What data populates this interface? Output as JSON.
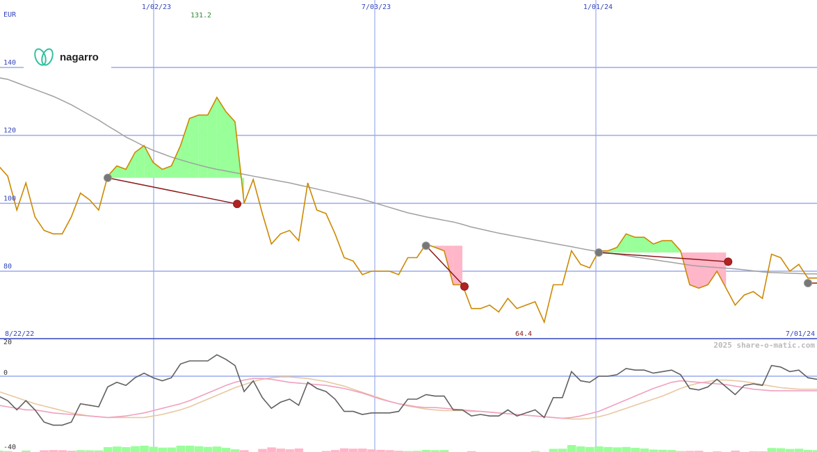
{
  "chart_data": [
    {
      "type": "line",
      "currency": "EUR",
      "y_ticks": [
        140,
        120,
        100,
        80
      ],
      "ylim": [
        64,
        145
      ],
      "date_labels": [
        "1/02/23",
        "7/03/23",
        "1/01/24"
      ],
      "start_date": "8/22/22",
      "end_date": "7/01/24",
      "max_label": "131.2",
      "min_label": "64.4",
      "series": [
        {
          "values": [
            111,
            108,
            98,
            106,
            96,
            92,
            91,
            91,
            96,
            103,
            101,
            98,
            108,
            111,
            110,
            115,
            117,
            112,
            110,
            111,
            117,
            125,
            126,
            126,
            131.2,
            127,
            124,
            100,
            107,
            97,
            88,
            91,
            92,
            89,
            106,
            98,
            97,
            91,
            84,
            83,
            79,
            80,
            80,
            80,
            79,
            84,
            84,
            88,
            87,
            86,
            76,
            76,
            69,
            69,
            70,
            68,
            72,
            69,
            70,
            71,
            65,
            76,
            76,
            86,
            82,
            81,
            86,
            86,
            87,
            91,
            90,
            90,
            88,
            89,
            89,
            86,
            76,
            75,
            76,
            80,
            75,
            70,
            73,
            74,
            72,
            85,
            84,
            80,
            82,
            78,
            78
          ]
        },
        {
          "values": [
            137,
            136.5,
            135.5,
            134.5,
            133.5,
            132.5,
            131.5,
            130.3,
            129,
            127.5,
            126,
            124.5,
            122.8,
            121.2,
            119.5,
            118.2,
            116.8,
            115.6,
            114.6,
            113.6,
            112.8,
            112,
            111.3,
            110.6,
            110,
            109.5,
            109,
            108.5,
            108,
            107.5,
            107,
            106.5,
            106,
            105.4,
            104.8,
            104.2,
            103.6,
            103,
            102.4,
            101.8,
            101.2,
            100.4,
            99.6,
            98.8,
            98,
            97.2,
            96.6,
            96,
            95.5,
            95,
            94.5,
            93.8,
            93,
            92.4,
            91.8,
            91.2,
            90.7,
            90.2,
            89.7,
            89.2,
            88.7,
            88.2,
            87.7,
            87.2,
            86.7,
            86.2,
            85.8,
            85.4,
            85,
            84.6,
            84.2,
            83.8,
            83.4,
            83,
            82.6,
            82.2,
            81.8,
            81.5,
            81.3,
            81.1,
            80.9,
            80.7,
            80.4,
            80.1,
            79.8,
            79.6,
            79.5,
            79.4,
            79.3,
            79.2,
            79.2
          ]
        }
      ],
      "trades": [
        {
          "entry": 107.5,
          "exit": 99.8,
          "result": "loss"
        },
        {
          "entry": 87.5,
          "exit": 75.5,
          "result": "loss"
        },
        {
          "entry": 85.5,
          "exit": 82.8,
          "result": "loss"
        }
      ],
      "colors": {
        "price": "#cc8800",
        "average": "#a0a0a0",
        "gain": "#99ff99",
        "loss": "#ffb6c8",
        "trade_line": "#8b1a1a",
        "grid": "#99aaee",
        "axis": "#3344bb"
      }
    },
    {
      "type": "line",
      "y_ticks": [
        20,
        0,
        -40
      ],
      "ylim": [
        -42,
        22
      ],
      "series": [
        {
          "values": [
            -13,
            -16,
            -22,
            -16,
            -22,
            -30,
            -32,
            -32,
            -30,
            -18,
            -19,
            -20,
            -7,
            -4,
            -6,
            -1,
            2,
            -1,
            -3,
            -1,
            8,
            10,
            10,
            10,
            14,
            11,
            7,
            -10,
            -3,
            -14,
            -21,
            -17,
            -15,
            -19,
            -4,
            -8,
            -10,
            -15,
            -23,
            -23,
            -25,
            -24,
            -24,
            -24,
            -23,
            -15,
            -15,
            -12,
            -13,
            -13,
            -22,
            -22,
            -26,
            -25,
            -26,
            -26,
            -22,
            -26,
            -24,
            -22,
            -27,
            -14,
            -14,
            3,
            -3,
            -4,
            0,
            0,
            1,
            5,
            4,
            4,
            2,
            3,
            4,
            1,
            -8,
            -9,
            -7,
            -2,
            -7,
            -12,
            -6,
            -5,
            -6,
            7,
            6,
            3,
            4,
            -1,
            -2
          ]
        },
        {
          "values": [
            -19,
            -20,
            -21,
            -22,
            -22,
            -23,
            -24,
            -24.5,
            -25,
            -25.5,
            -26,
            -26.5,
            -27,
            -26.5,
            -26,
            -25,
            -24,
            -22.5,
            -21,
            -19.5,
            -18,
            -16,
            -13.5,
            -11,
            -8.5,
            -6,
            -4,
            -2.5,
            -1.5,
            -1.5,
            -2,
            -3,
            -4,
            -4.5,
            -5,
            -5.5,
            -6,
            -7,
            -8,
            -9.5,
            -11,
            -13,
            -15,
            -16.5,
            -18,
            -19,
            -20,
            -20.5,
            -20.5,
            -21,
            -21.5,
            -22,
            -22.5,
            -23,
            -23.5,
            -24,
            -24.5,
            -25,
            -25.5,
            -26,
            -26.5,
            -27,
            -27.5,
            -27,
            -26,
            -24.5,
            -23,
            -20.5,
            -18,
            -15.5,
            -13,
            -10.5,
            -8,
            -6,
            -4,
            -3,
            -3.5,
            -4,
            -4.5,
            -5,
            -5.5,
            -6.5,
            -7.5,
            -8.5,
            -9,
            -9.5,
            -9.5,
            -9.5,
            -9.5,
            -9.5,
            -9.5
          ]
        },
        {
          "values": [
            -10,
            -12,
            -14,
            -16,
            -18,
            -19.5,
            -21,
            -22.5,
            -24,
            -25,
            -26,
            -26.5,
            -27,
            -27,
            -27,
            -27,
            -27,
            -26,
            -25,
            -23.5,
            -22,
            -20,
            -17.5,
            -15,
            -12.5,
            -10,
            -7.5,
            -5.5,
            -3.5,
            -2,
            -1,
            -0.5,
            -0.5,
            -1,
            -1.5,
            -2.5,
            -3.5,
            -5,
            -6.5,
            -8.5,
            -10.5,
            -12.5,
            -14.5,
            -16.5,
            -18,
            -19.5,
            -20.5,
            -21.5,
            -22,
            -22.5,
            -22.5,
            -22.5,
            -23,
            -23,
            -23.5,
            -24,
            -24.5,
            -25,
            -25.5,
            -26,
            -26.5,
            -27,
            -27.5,
            -28,
            -28,
            -27.5,
            -26.5,
            -25,
            -23,
            -21,
            -19,
            -17,
            -15,
            -13,
            -10.5,
            -8,
            -6,
            -4.5,
            -3.5,
            -2.5,
            -2.5,
            -3,
            -3.5,
            -4.5,
            -5.5,
            -6.5,
            -7.5,
            -8,
            -8.5,
            -8.5,
            -8.5
          ]
        }
      ],
      "colors": {
        "oscillator": "#606060",
        "signal_a": "#f0a0c0",
        "signal_b": "#e8c8a0"
      }
    }
  ],
  "footer": {
    "watermark": "2025 share-o-matic.com"
  },
  "logo": {
    "text": "nagarro"
  }
}
